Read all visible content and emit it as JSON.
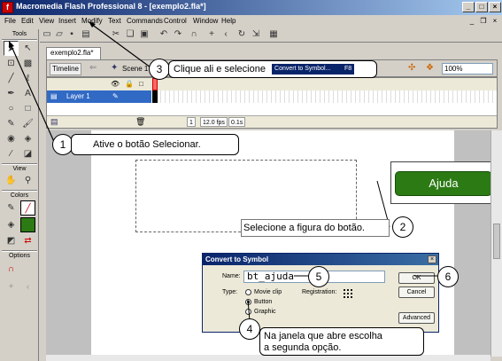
{
  "window": {
    "title": "Macromedia Flash Professional 8 - [exemplo2.fla*]",
    "minimize": "_",
    "maximize": "□",
    "close": "×"
  },
  "menu": [
    "File",
    "Edit",
    "View",
    "Insert",
    "Modify",
    "Text",
    "Commands",
    "Control",
    "Window",
    "Help"
  ],
  "tools": {
    "title": "Tools",
    "view_label": "View",
    "colors_label": "Colors",
    "options_label": "Options"
  },
  "document": {
    "tab": "exemplo2.fla*",
    "timeline_button": "Timeline",
    "scene": "Scene 1",
    "zoom": "100%",
    "layer_name": "Layer 1",
    "frame": "1",
    "fps": "12.0 fps",
    "time": "0.1s"
  },
  "stage": {
    "button_text": "Ajuda"
  },
  "dialog": {
    "title": "Convert to Symbol",
    "name_label": "Name:",
    "name_value": "bt_ajuda",
    "type_label": "Type:",
    "types": [
      "Movie clip",
      "Button",
      "Graphic"
    ],
    "registration_label": "Registration:",
    "ok": "OK",
    "cancel": "Cancel",
    "advanced": "Advanced"
  },
  "annotations": {
    "step1": {
      "num": "1",
      "text": "Ative o botão Selecionar."
    },
    "step2": {
      "num": "2",
      "text": "Selecione  a figura do botão."
    },
    "step3": {
      "num": "3",
      "text": "Clique  ali e selecione",
      "menu_item": "Convert to Symbol...",
      "shortcut": "F8"
    },
    "step4": {
      "num": "4",
      "line1": "Na janela que abre escolha",
      "line2": "a segunda opção."
    },
    "step5": {
      "num": "5"
    },
    "step6": {
      "num": "6"
    }
  }
}
